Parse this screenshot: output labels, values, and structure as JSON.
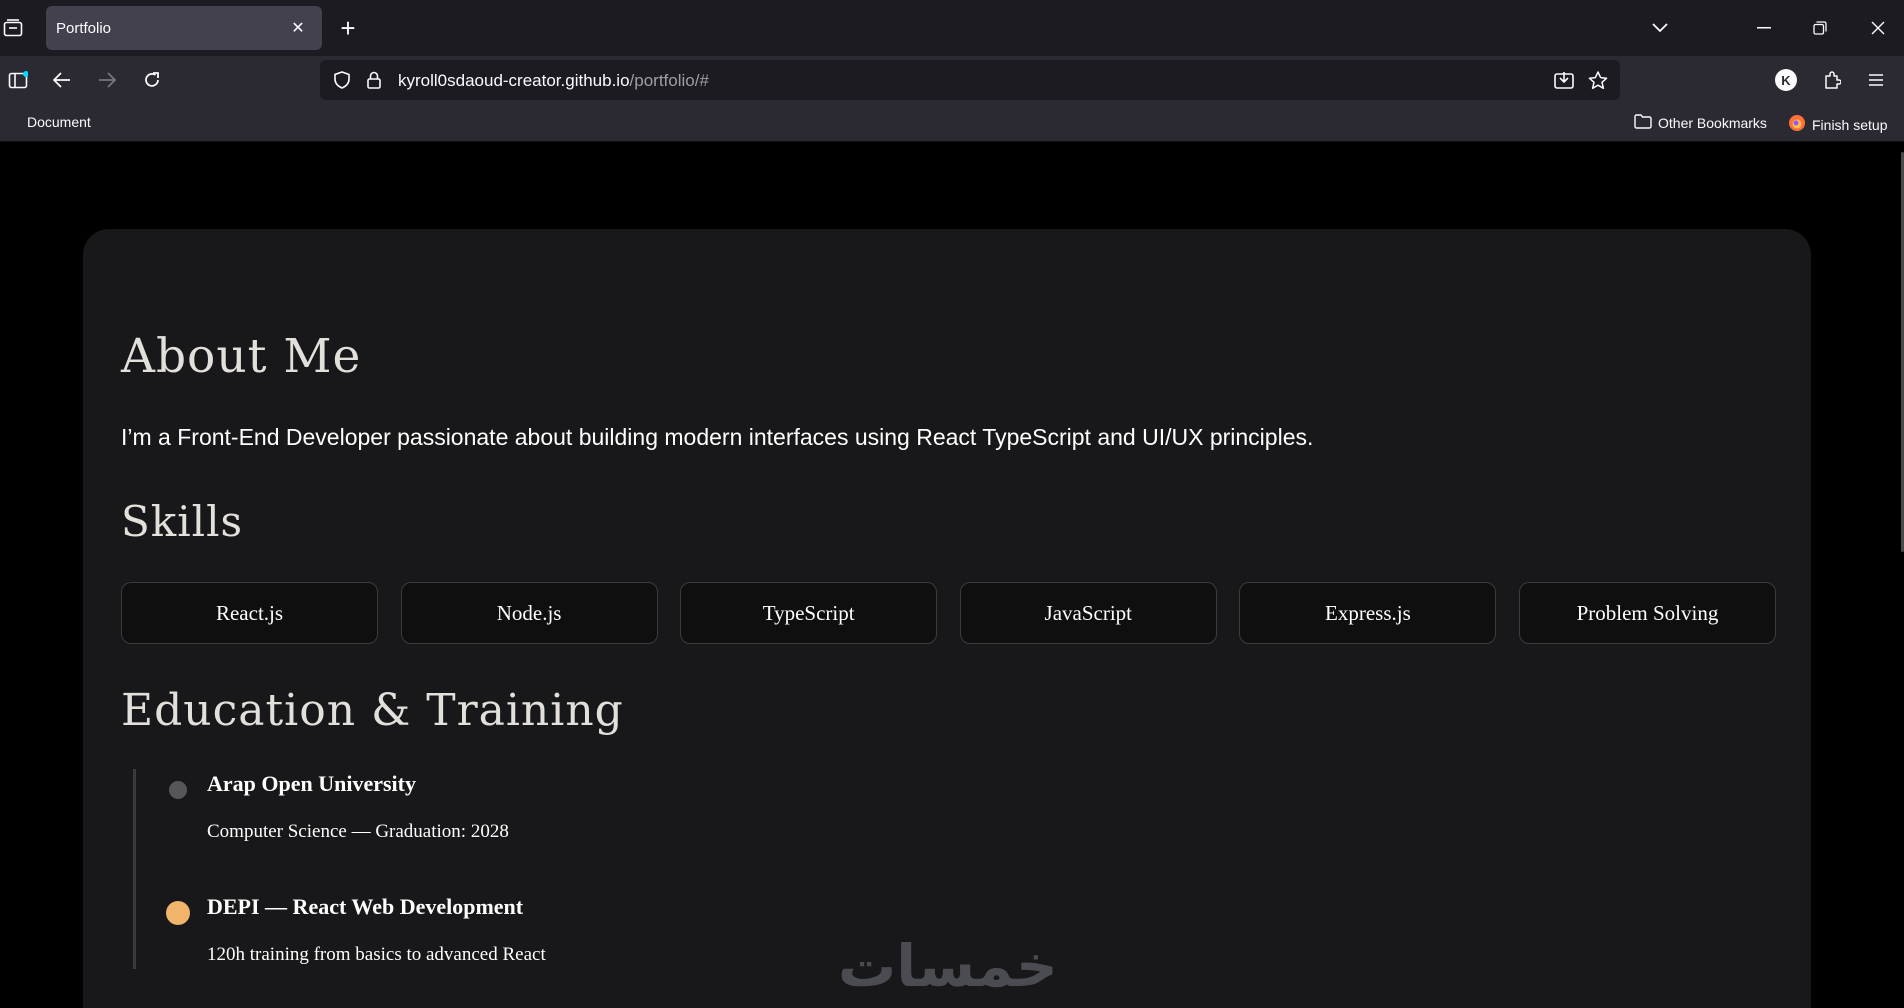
{
  "browser": {
    "tab_title": "Portfolio",
    "tab_close": "✕",
    "new_tab": "+",
    "url_domain": "kyroll0sdaoud-creator.github.io",
    "url_path": "/portfolio/#",
    "avatar_letter": "K",
    "bookmarks": {
      "document": "Document",
      "other": "Other Bookmarks",
      "finish_setup": "Finish setup"
    }
  },
  "page": {
    "about_heading": "About Me",
    "about_text": "I’m a Front-End Developer passionate about building modern interfaces using React TypeScript and UI/UX principles.",
    "skills_heading": "Skills",
    "skills": [
      "React.js",
      "Node.js",
      "TypeScript",
      "JavaScript",
      "Express.js",
      "Problem Solving"
    ],
    "education_heading": "Education & Training",
    "education": [
      {
        "title": "Arap Open University",
        "desc": "Computer Science — Graduation: 2028",
        "dot_color": "#55555a"
      },
      {
        "title": "DEPI — React Web Development",
        "desc": "120h training from basics to advanced React",
        "dot_color": "#f0b46a"
      }
    ],
    "watermark": "خمسات"
  }
}
